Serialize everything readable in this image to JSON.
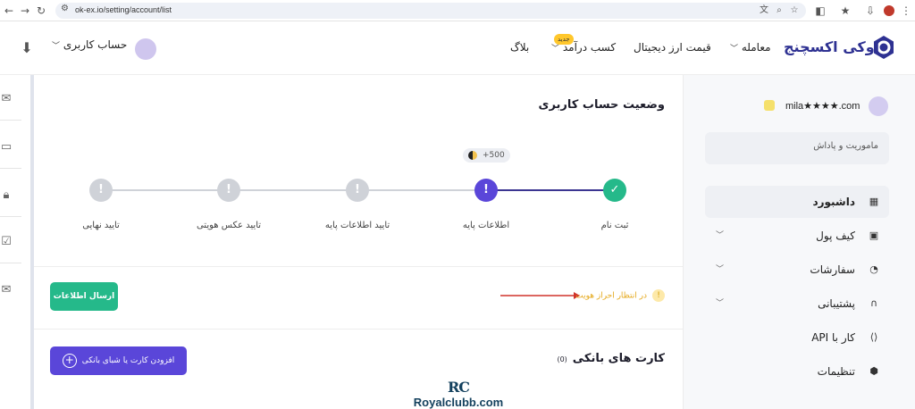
{
  "browser": {
    "url": "ok-ex.io/setting/account/list"
  },
  "header": {
    "brand": "اوکی اکسچنج",
    "nav": {
      "trade": "معامله",
      "prices": "قیمت ارز دیجیتال",
      "earn": "کسب درآمد",
      "earn_badge": "جدید",
      "blog": "بلاگ"
    },
    "account_label": "حساب کاربری"
  },
  "main": {
    "status_title": "وضعیت حساب کاربری",
    "reward": "+500",
    "steps": [
      {
        "label": "ثبت نام",
        "state": "done"
      },
      {
        "label": "اطلاعات پایه",
        "state": "current"
      },
      {
        "label": "تایید اطلاعات پایه",
        "state": "pending"
      },
      {
        "label": "تایید عکس هویتی",
        "state": "pending"
      },
      {
        "label": "تایید نهایی",
        "state": "pending"
      }
    ],
    "pending_text": "در انتظار احراز هویت",
    "send_button": "ارسال اطلاعات",
    "cards_title": "کارت های بانکی",
    "cards_count": "(0)",
    "add_card_button": "افزودن کارت یا شبای بانکی",
    "watermark_logo": "RC",
    "watermark_site": "Royalclubb.com"
  },
  "sidebar": {
    "email": "mila★★★★.com",
    "mission": "ماموریت و پاداش",
    "items": [
      {
        "label": "داشبورد",
        "icon": "grid-icon",
        "active": true,
        "expandable": false
      },
      {
        "label": "کیف پول",
        "icon": "wallet-icon",
        "active": false,
        "expandable": true
      },
      {
        "label": "سفارشات",
        "icon": "pie-chart-icon",
        "active": false,
        "expandable": true
      },
      {
        "label": "پشتیبانی",
        "icon": "headset-icon",
        "active": false,
        "expandable": true
      },
      {
        "label": "کار با API",
        "icon": "code-icon",
        "active": false,
        "expandable": false
      },
      {
        "label": "تنظیمات",
        "icon": "settings-icon",
        "active": false,
        "expandable": false
      }
    ]
  },
  "colors": {
    "brand": "#2e3192",
    "primary": "#5a46d9",
    "success": "#25b98a",
    "warning": "#e5a91c",
    "pending_step": "#cfd2d8",
    "arrow": "#d0342c"
  }
}
